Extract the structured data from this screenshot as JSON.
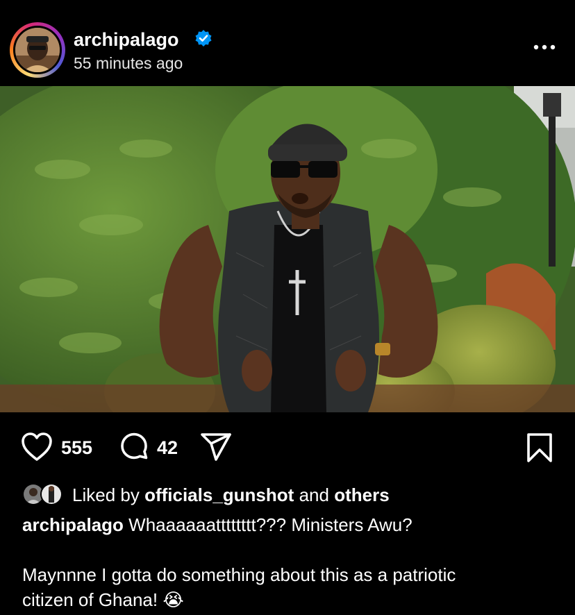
{
  "post": {
    "username": "archipalago",
    "timestamp": "55 minutes ago",
    "verified": true
  },
  "actions": {
    "like_count": "555",
    "comment_count": "42"
  },
  "likes": {
    "prefix": "Liked by",
    "user": "officials_gunshot",
    "conjunction": "and",
    "others": "others"
  },
  "caption": {
    "username": "archipalago",
    "line1": "Whaaaaaatttttttt??? Ministers Awu?",
    "line2": "Maynnne I gotta do something about this as a patriotic",
    "line3": "citizen of Ghana! 😭"
  },
  "icons": {
    "verified": "verified-badge-icon",
    "more": "more-options-icon",
    "like": "heart-icon",
    "comment": "comment-bubble-icon",
    "share": "paper-plane-icon",
    "save": "bookmark-icon"
  },
  "colors": {
    "background": "#000000",
    "verified": "#0095f6",
    "text": "#ffffff"
  }
}
